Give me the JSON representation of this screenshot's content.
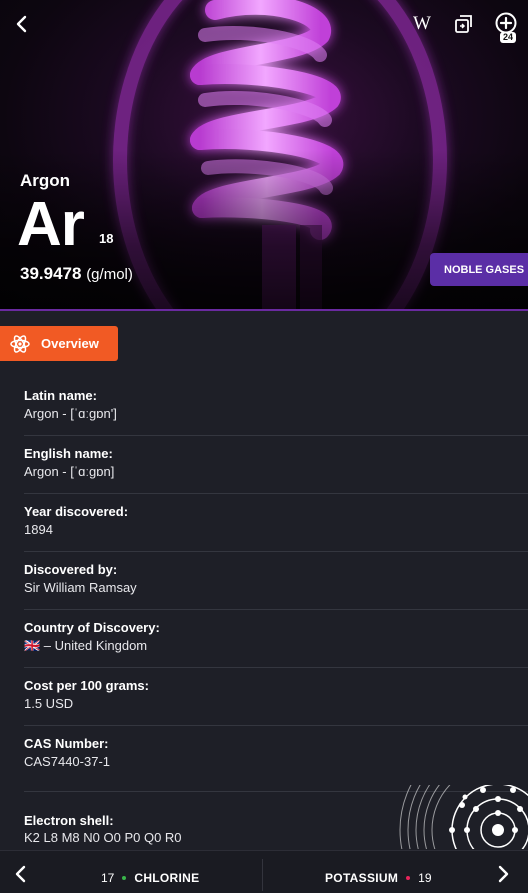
{
  "element": {
    "name": "Argon",
    "symbol": "Ar",
    "atomic_number": "18",
    "atomic_mass": "39.9478",
    "mass_unit": "(g/mol)",
    "category": "NOBLE GASES"
  },
  "header": {
    "wiki_label": "W",
    "compare_count": "24"
  },
  "tab": {
    "label": "Overview"
  },
  "properties": [
    {
      "label": "Latin name:",
      "value": "Argon - [ˈɑːɡɒn']"
    },
    {
      "label": "English name:",
      "value": "Argon - [ˈɑːɡɒn]"
    },
    {
      "label": "Year discovered:",
      "value": "1894"
    },
    {
      "label": "Discovered by:",
      "value": "Sir William Ramsay"
    },
    {
      "label": "Country of Discovery:",
      "value": "🇬🇧 – United Kingdom"
    },
    {
      "label": "Cost per 100 grams:",
      "value": "1.5 USD"
    },
    {
      "label": "CAS Number:",
      "value": "CAS7440-37-1"
    }
  ],
  "electron_shell": {
    "label": "Electron shell:",
    "value": "K2 L8 M8 N0 O0 P0 Q0 R0"
  },
  "nav": {
    "prev": {
      "number": "17",
      "name": "CHLORINE",
      "dot_color": "#39b54a"
    },
    "next": {
      "name": "POTASSIUM",
      "number": "19",
      "dot_color": "#e8245a"
    }
  },
  "colors": {
    "accent": "#f15a24",
    "category": "#5b2ea6",
    "background": "#1e1f27"
  }
}
